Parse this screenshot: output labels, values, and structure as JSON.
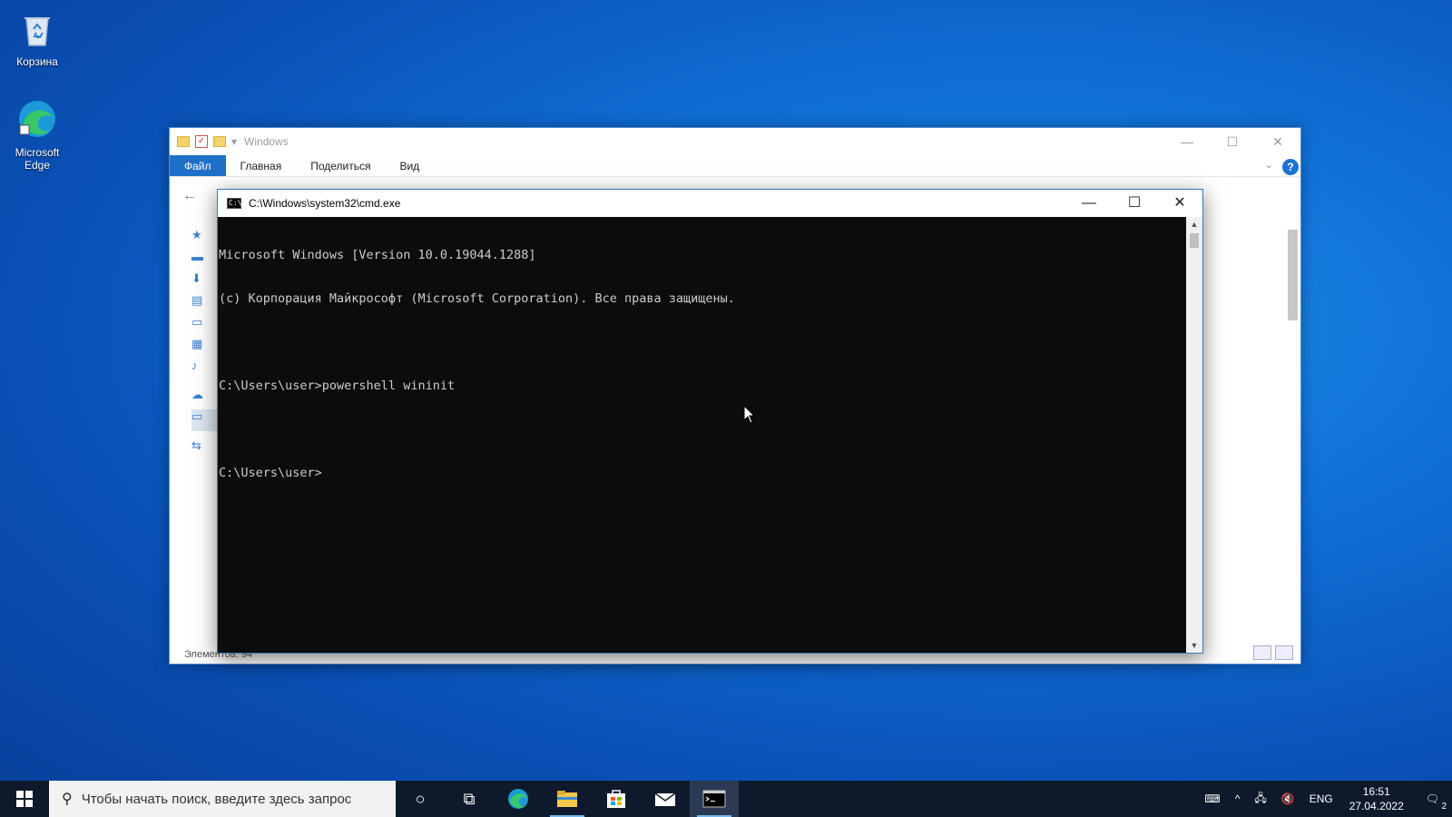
{
  "desktop": {
    "icons": [
      {
        "label": "Корзина"
      },
      {
        "label": "Microsoft Edge"
      }
    ]
  },
  "explorer": {
    "title": "Windows",
    "tabs": [
      "Файл",
      "Главная",
      "Поделиться",
      "Вид"
    ],
    "status": "Элементов: 94",
    "help": "?"
  },
  "cmd": {
    "title": "C:\\Windows\\system32\\cmd.exe",
    "lines": [
      "Microsoft Windows [Version 10.0.19044.1288]",
      "(c) Корпорация Майкрософт (Microsoft Corporation). Все права защищены.",
      "",
      "C:\\Users\\user>powershell wininit",
      "",
      "C:\\Users\\user>"
    ]
  },
  "taskbar": {
    "search_placeholder": "Чтобы начать поиск, введите здесь запрос",
    "lang": "ENG",
    "time": "16:51",
    "date": "27.04.2022",
    "notifications_count": "2"
  },
  "colors": {
    "accent": "#1e6fc7",
    "console_bg": "#0c0c0c",
    "console_fg": "#cccccc",
    "taskbar_bg": "#0e1a2c"
  }
}
